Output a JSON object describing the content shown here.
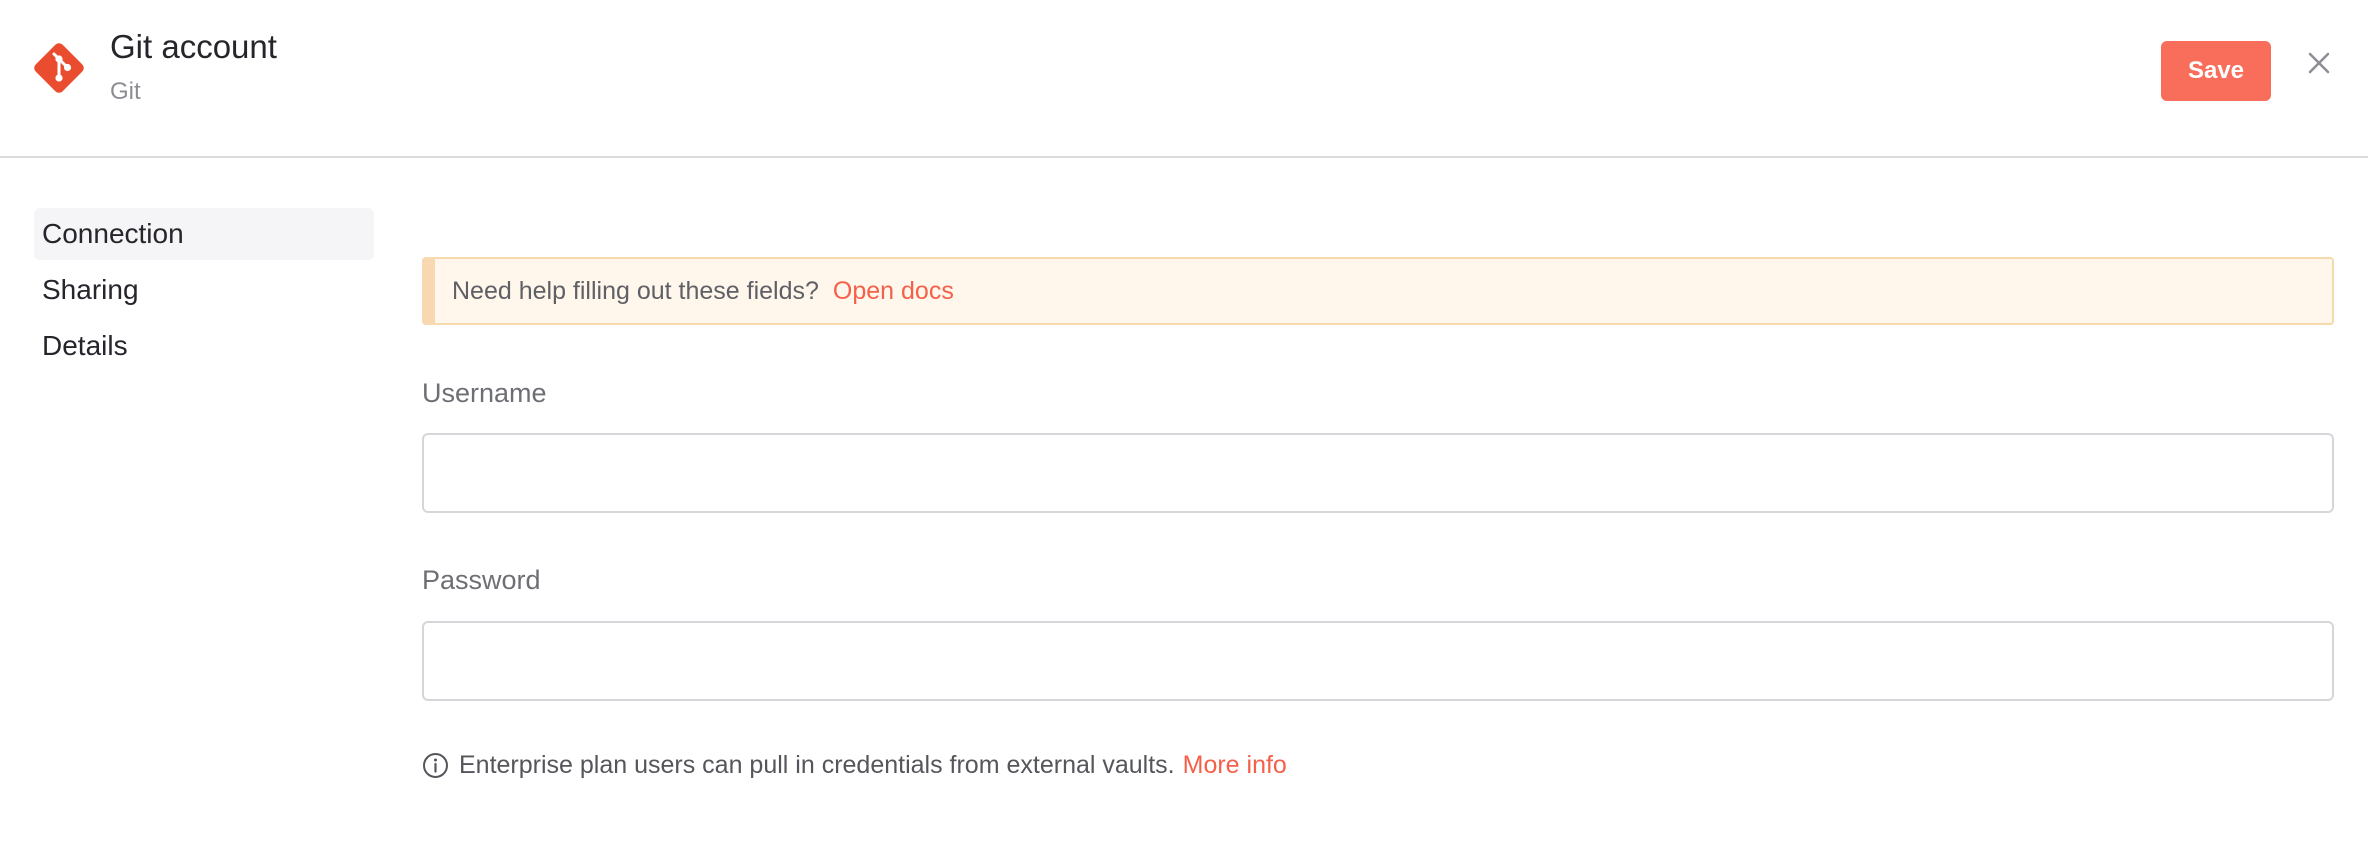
{
  "header": {
    "title": "Git account",
    "subtitle": "Git",
    "save_label": "Save",
    "logo_icon": "git-logo-icon",
    "close_icon": "close-icon"
  },
  "sidebar": {
    "items": [
      {
        "label": "Connection",
        "active": true
      },
      {
        "label": "Sharing",
        "active": false
      },
      {
        "label": "Details",
        "active": false
      }
    ]
  },
  "main": {
    "callout_text": "Need help filling out these fields?",
    "callout_link": "Open docs",
    "fields": [
      {
        "label": "Username",
        "value": "",
        "placeholder": ""
      },
      {
        "label": "Password",
        "value": "",
        "placeholder": ""
      }
    ],
    "note_text": "Enterprise plan users can pull in credentials from external vaults.",
    "note_link": "More info"
  },
  "colors": {
    "accent": "#f86e5b",
    "logo": "#ea4c30",
    "callout_bg": "#fff7ec",
    "callout_border": "#f6d9ad"
  }
}
